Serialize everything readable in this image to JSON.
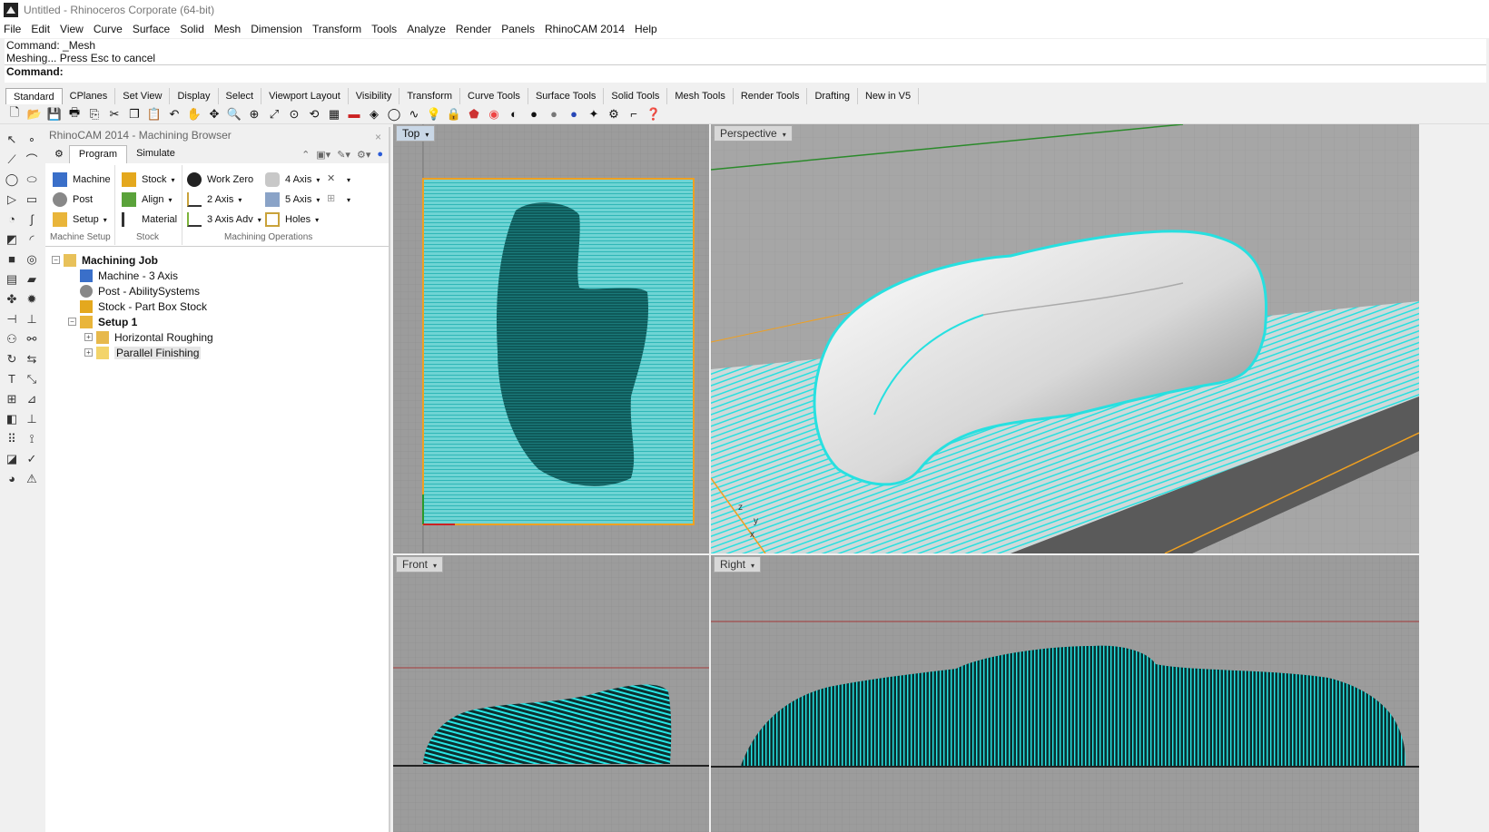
{
  "window": {
    "title": "Untitled - Rhinoceros Corporate (64-bit)"
  },
  "menu": [
    "File",
    "Edit",
    "View",
    "Curve",
    "Surface",
    "Solid",
    "Mesh",
    "Dimension",
    "Transform",
    "Tools",
    "Analyze",
    "Render",
    "Panels",
    "RhinoCAM 2014",
    "Help"
  ],
  "command": {
    "line1": "Command: _Mesh",
    "line2": "Meshing... Press Esc to cancel",
    "prompt": "Command:"
  },
  "toolbar_tabs": [
    "Standard",
    "CPlanes",
    "Set View",
    "Display",
    "Select",
    "Viewport Layout",
    "Visibility",
    "Transform",
    "Curve Tools",
    "Surface Tools",
    "Solid Tools",
    "Mesh Tools",
    "Render Tools",
    "Drafting",
    "New in V5"
  ],
  "browser": {
    "title": "RhinoCAM 2014 - Machining Browser",
    "tabs": [
      "Program",
      "Simulate"
    ],
    "ribbon": {
      "machine": "Machine",
      "post": "Post",
      "setup": "Setup",
      "stock": "Stock",
      "align": "Align",
      "material": "Material",
      "work_zero": "Work Zero",
      "two_axis": "2 Axis",
      "three_axis_adv": "3 Axis Adv",
      "four_axis": "4 Axis",
      "five_axis": "5 Axis",
      "holes": "Holes",
      "group_machine_setup": "Machine Setup",
      "group_stock": "Stock",
      "group_ops": "Machining Operations"
    },
    "tree": {
      "job": "Machining Job",
      "machine": "Machine - 3 Axis",
      "post": "Post - AbilitySystems",
      "stock": "Stock - Part Box Stock",
      "setup": "Setup 1",
      "op1": "Horizontal Roughing",
      "op2": "Parallel Finishing"
    }
  },
  "viewports": {
    "top": "Top",
    "perspective": "Perspective",
    "front": "Front",
    "right": "Right"
  },
  "colors": {
    "toolpath": "#2ce8e8",
    "grid_bg": "#9c9c9c",
    "stock_border": "#f0a020"
  }
}
